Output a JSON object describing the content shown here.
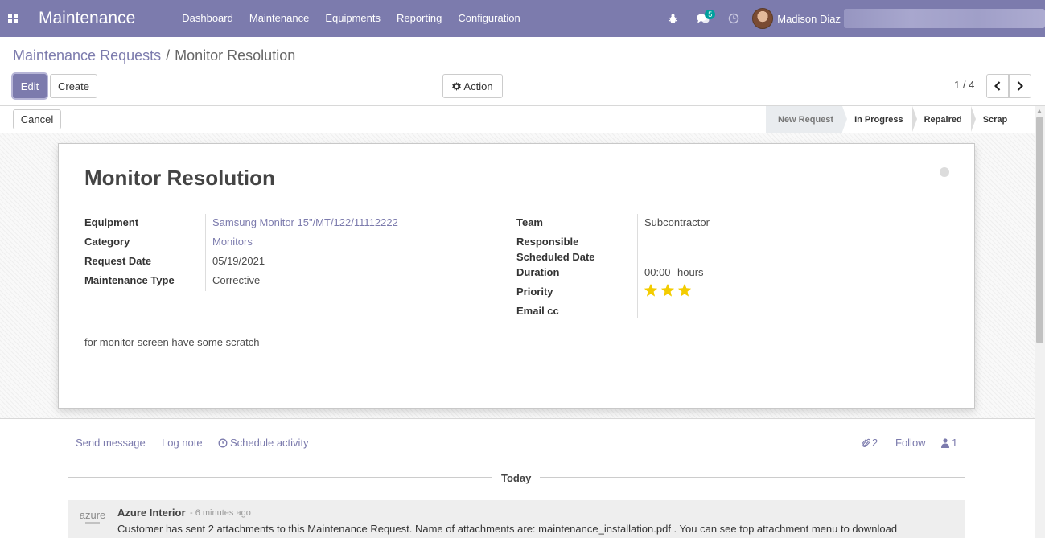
{
  "navbar": {
    "app_name": "Maintenance",
    "menu": [
      "Dashboard",
      "Maintenance",
      "Equipments",
      "Reporting",
      "Configuration"
    ],
    "messages_badge": "5",
    "user_name": "Madison Diaz",
    "color": "#7c7bad"
  },
  "breadcrumb": {
    "parent": "Maintenance Requests",
    "separator": "/",
    "current": "Monitor Resolution"
  },
  "buttons": {
    "edit": "Edit",
    "create": "Create",
    "action": "Action",
    "cancel": "Cancel"
  },
  "pager": {
    "value": "1 / 4"
  },
  "statusbar": {
    "stages": [
      "New Request",
      "In Progress",
      "Repaired",
      "Scrap"
    ],
    "active": "New Request"
  },
  "form": {
    "title": "Monitor Resolution",
    "left_fields": [
      {
        "label": "Equipment",
        "value": "Samsung Monitor 15\"/MT/122/11112222"
      },
      {
        "label": "Category",
        "value": "Monitors"
      },
      {
        "label": "Request Date",
        "value": "05/19/2021"
      },
      {
        "label": "Maintenance Type",
        "value": "Corrective"
      }
    ],
    "right_fields": {
      "team_label": "Team",
      "team_value": "Subcontractor",
      "responsible_label": "Responsible",
      "scheduled_label": "Scheduled Date",
      "duration_label": "Duration",
      "duration_value": "00:00",
      "duration_unit": "hours",
      "priority_label": "Priority",
      "priority_value": 3,
      "priority_max": 3,
      "email_cc_label": "Email cc"
    },
    "description": "for monitor screen have some scratch"
  },
  "chatter": {
    "send_message": "Send message",
    "log_note": "Log note",
    "schedule_activity": "Schedule activity",
    "attachments_count": "2",
    "follow": "Follow",
    "followers_count": "1",
    "today_label": "Today",
    "message": {
      "logo_text": "azure",
      "author": "Azure Interior",
      "time": "- 6 minutes ago",
      "body": "Customer has sent 2 attachments to this Maintenance Request. Name of attachments are: maintenance_installation.pdf . You can see top attachment menu to download"
    }
  }
}
